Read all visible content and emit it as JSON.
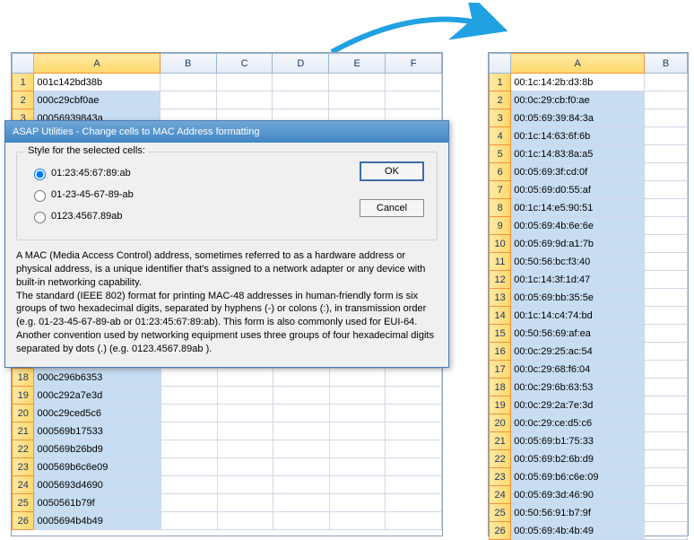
{
  "dialog": {
    "title": "ASAP Utilities - Change cells to MAC Address formatting",
    "group_title": "Style for the selected cells:",
    "opt1": "01:23:45:67:89:ab",
    "opt2": "01-23-45-67-89-ab",
    "opt3": "0123.4567.89ab",
    "ok": "OK",
    "cancel": "Cancel",
    "desc1": "A MAC (Media Access Control) address, sometimes referred to as a hardware address or physical address, is a unique identifier that's assigned to a network adapter or any device with built-in networking capability.",
    "desc2": "The standard (IEEE 802) format for printing MAC-48 addresses in human-friendly form is six groups of two hexadecimal digits, separated by hyphens (-) or colons (:), in transmission order (e.g. 01-23-45-67-89-ab or 01:23:45:67:89:ab). This form is also commonly used for EUI-64. Another convention used by networking equipment uses three groups of four hexadecimal digits separated by dots (.) (e.g. 0123.4567.89ab )."
  },
  "left": {
    "cols": [
      "A",
      "B",
      "C",
      "D",
      "E",
      "F"
    ],
    "rows": {
      "1": "001c142bd38b",
      "2": "000c29cbf0ae",
      "3": "00056939843a",
      "4": "",
      "18": "000c296b6353",
      "19": "000c292a7e3d",
      "20": "000c29ced5c6",
      "21": "000569b17533",
      "22": "000569b26bd9",
      "23": "000569b6c6e09",
      "24": "0005693d4690",
      "25": "0050561b79f",
      "26": "0005694b4b49"
    }
  },
  "right": {
    "cols": [
      "A",
      "B"
    ],
    "rows": {
      "1": "00:1c:14:2b:d3:8b",
      "2": "00:0c:29:cb:f0:ae",
      "3": "00:05:69:39:84:3a",
      "4": "00:1c:14:63:6f:6b",
      "5": "00:1c:14:83:8a:a5",
      "6": "00:05:69:3f:cd:0f",
      "7": "00:05:69:d0:55:af",
      "8": "00:1c:14:e5:90:51",
      "9": "00:05:69:4b:6e:6e",
      "10": "00:05:69:9d:a1:7b",
      "11": "00:50:56:bc:f3:40",
      "12": "00:1c:14:3f:1d:47",
      "13": "00:05:69:bb:35:5e",
      "14": "00:1c:14:c4:74:bd",
      "15": "00:50:56:69:af:ea",
      "16": "00:0c:29:25:ac:54",
      "17": "00:0c:29:68:f6:04",
      "18": "00:0c:29:6b:63:53",
      "19": "00:0c:29:2a:7e:3d",
      "20": "00:0c:29:ce:d5:c6",
      "21": "00:05:69:b1:75:33",
      "22": "00:05:69:b2:6b:d9",
      "23": "00:05:69:b6:c6e:09",
      "24": "00:05:69:3d:46:90",
      "25": "00:50:56:91:b7:9f",
      "26": "00:05:69:4b:4b:49"
    }
  }
}
